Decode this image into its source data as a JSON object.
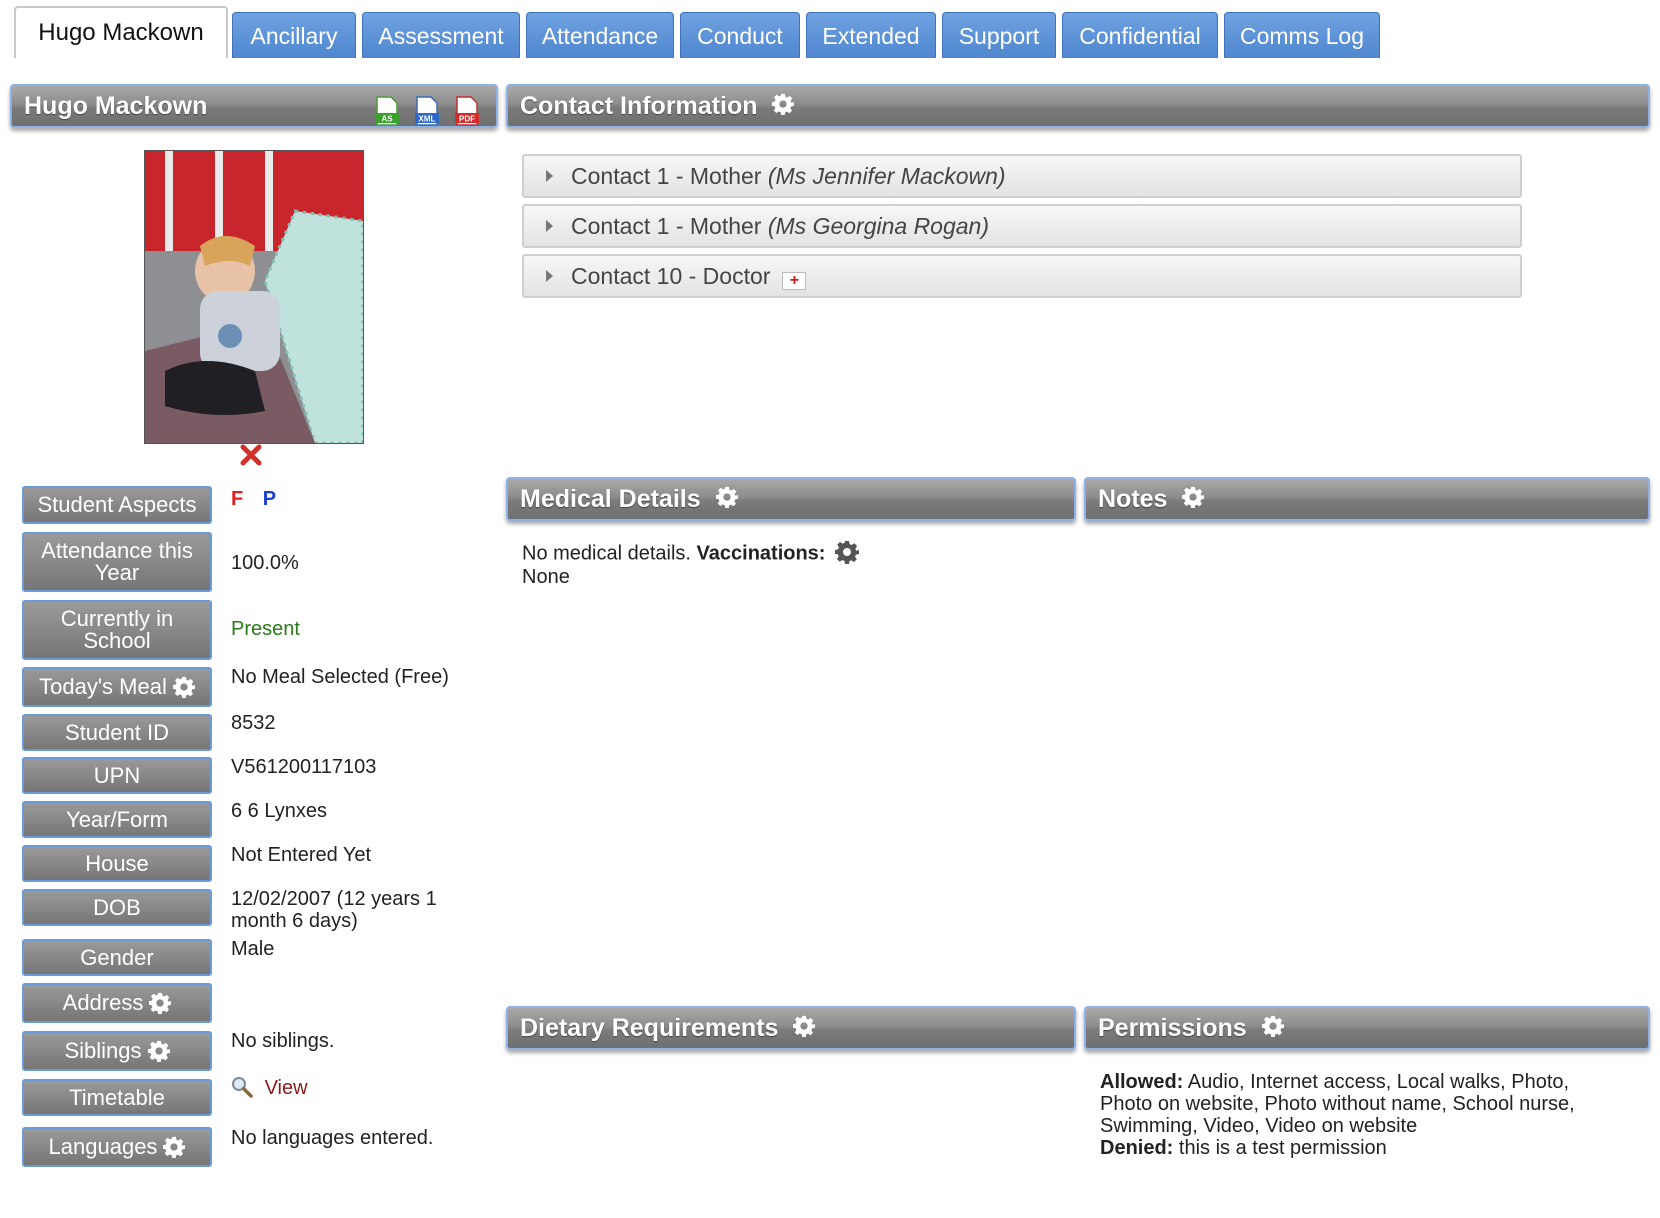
{
  "tabs": [
    {
      "label": "Hugo Mackown",
      "active": true
    },
    {
      "label": "Ancillary"
    },
    {
      "label": "Assessment"
    },
    {
      "label": "Attendance"
    },
    {
      "label": "Conduct"
    },
    {
      "label": "Extended"
    },
    {
      "label": "Support"
    },
    {
      "label": "Confidential"
    },
    {
      "label": "Comms Log"
    }
  ],
  "student_panel": {
    "title": "Hugo Mackown",
    "export_icons": [
      "as-export-icon",
      "xml-export-icon",
      "pdf-export-icon"
    ],
    "export_icon_labels": [
      "AS",
      "XML",
      "PDF"
    ],
    "aspects": [
      "F",
      "P"
    ],
    "aspect_colors": [
      "#e02020",
      "#1a3ecf"
    ]
  },
  "fields": {
    "student_aspects": {
      "label": "Student Aspects"
    },
    "attendance": {
      "label_line1": "Attendance this",
      "label_line2": "Year",
      "value": "100.0%"
    },
    "in_school": {
      "label_line1": "Currently in",
      "label_line2": "School",
      "value": "Present",
      "value_color": "#2a7a1a"
    },
    "meal": {
      "label": "Today's Meal",
      "value": "No Meal Selected (Free)"
    },
    "student_id": {
      "label": "Student ID",
      "value": "8532"
    },
    "upn": {
      "label": "UPN",
      "value": "V561200117103"
    },
    "year_form": {
      "label": "Year/Form",
      "value": "6 6 Lynxes"
    },
    "house": {
      "label": "House",
      "value": "Not Entered Yet"
    },
    "dob": {
      "label": "DOB",
      "value_line1": "12/02/2007 (12 years 1",
      "value_line2": "month 6 days)"
    },
    "gender": {
      "label": "Gender",
      "value": "Male"
    },
    "address": {
      "label": "Address"
    },
    "siblings": {
      "label": "Siblings",
      "value": "No siblings."
    },
    "timetable": {
      "label": "Timetable",
      "value": "View"
    },
    "languages": {
      "label": "Languages",
      "value": "No languages entered."
    }
  },
  "contact_info": {
    "title": "Contact Information",
    "contacts": [
      {
        "text": "Contact 1 - Mother ",
        "name": "(Ms Jennifer Mackown)"
      },
      {
        "text": "Contact 1 - Mother ",
        "name": "(Ms Georgina Rogan)"
      },
      {
        "text": "Contact 10 - Doctor",
        "name": ""
      }
    ]
  },
  "medical": {
    "title": "Medical Details",
    "text": "No medical details. ",
    "vacc_label": "Vaccinations:",
    "vacc_value": "None"
  },
  "notes": {
    "title": "Notes"
  },
  "dietary": {
    "title": "Dietary Requirements"
  },
  "permissions": {
    "title": "Permissions",
    "allowed_label": "Allowed:",
    "allowed_line1": " Audio, Internet access, Local walks, Photo,",
    "allowed_line2": "Photo on website, Photo without name, School nurse,",
    "allowed_line3": "Swimming, Video, Video on website",
    "denied_label": "Denied:",
    "denied_value": " this is a test permission"
  },
  "colors": {
    "tab_blue": "#5b8fd6",
    "header_grey": "#8c8c8c",
    "present_green": "#2a7a1a",
    "link_red": "#8b1a1a"
  }
}
